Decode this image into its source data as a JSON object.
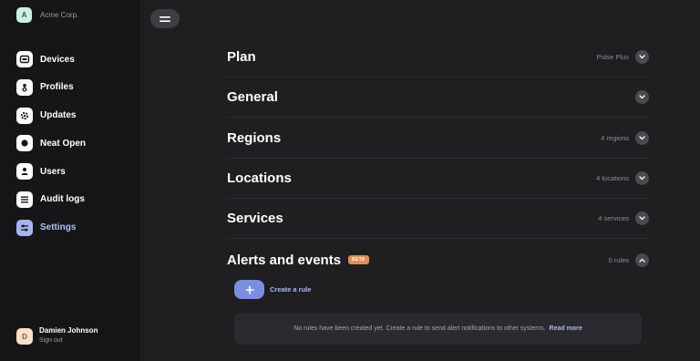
{
  "org": {
    "initial": "A",
    "name": "Acme Corp."
  },
  "nav": [
    {
      "label": "Devices",
      "icon": "device-icon"
    },
    {
      "label": "Profiles",
      "icon": "profiles-icon"
    },
    {
      "label": "Updates",
      "icon": "updates-icon"
    },
    {
      "label": "Neat Open",
      "icon": "neat-open-icon"
    },
    {
      "label": "Users",
      "icon": "user-icon"
    },
    {
      "label": "Audit logs",
      "icon": "list-icon"
    },
    {
      "label": "Settings",
      "icon": "sliders-icon",
      "active": true
    }
  ],
  "user": {
    "initial": "D",
    "name": "Damien Johnson",
    "sign_out": "Sign out"
  },
  "sections": [
    {
      "title": "Plan",
      "meta": "Pulse Plus",
      "expanded": false
    },
    {
      "title": "General",
      "meta": "",
      "expanded": false
    },
    {
      "title": "Regions",
      "meta": "4 regions",
      "expanded": false
    },
    {
      "title": "Locations",
      "meta": "4 locations",
      "expanded": false
    },
    {
      "title": "Services",
      "meta": "4 services",
      "expanded": false
    },
    {
      "title": "Alerts and events",
      "badge": "BETA",
      "meta": "0 rules",
      "expanded": true
    }
  ],
  "alerts": {
    "create_label": "Create a rule",
    "empty_text": "No rules have been created yet. Create a rule to send alert notifications to other systems.",
    "read_more": "Read more"
  },
  "colors": {
    "accent": "#7b8fe0",
    "beta_badge": "#e38d4e",
    "sidebar_bg": "#161618",
    "main_bg": "#1f1f22"
  }
}
